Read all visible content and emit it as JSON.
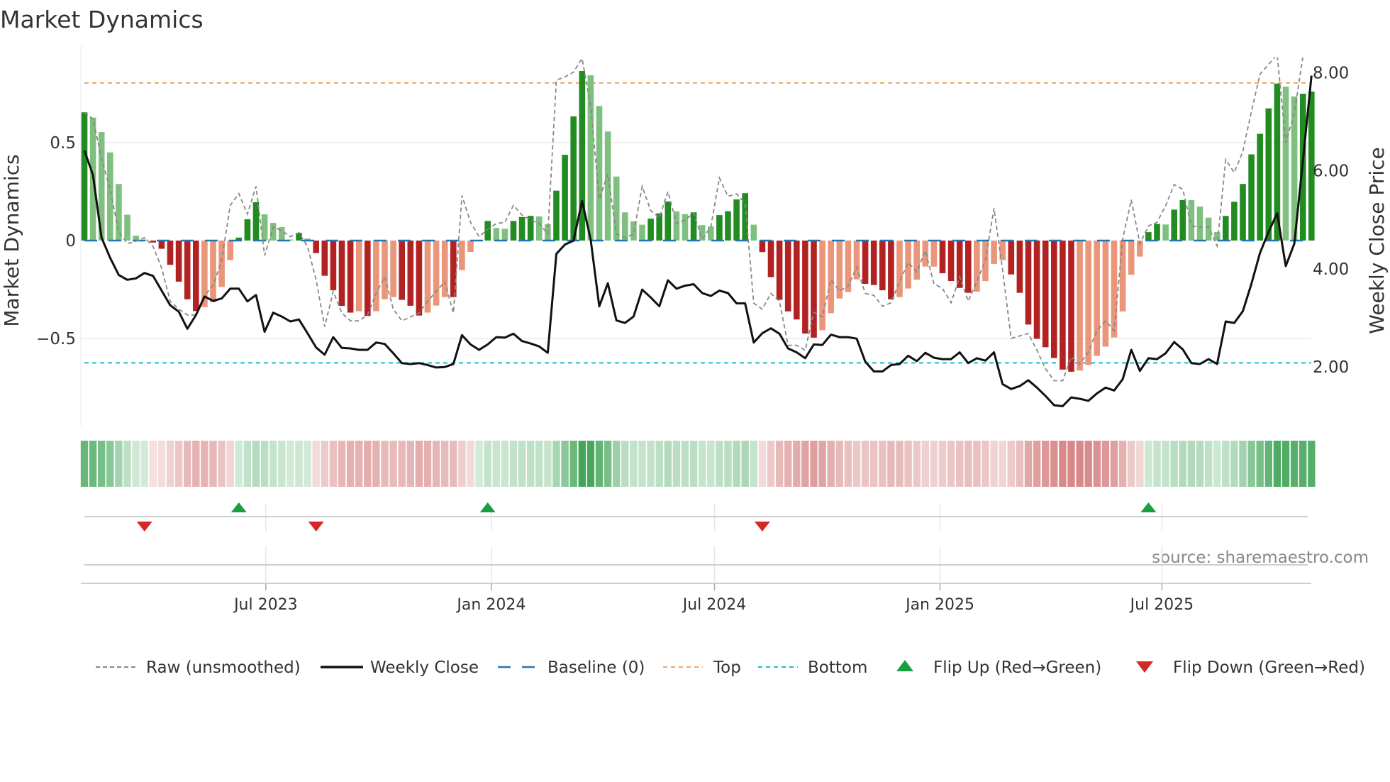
{
  "chart_data": {
    "type": "bar",
    "title": "Market Dynamics",
    "ylabel": "Market Dynamics",
    "y2label": "Weekly Close Price",
    "ylim": [
      -0.946,
      0.935
    ],
    "y2lim": [
      0.78,
      8.3
    ],
    "yticks": [
      {
        "v": 0.5,
        "label": "0.5"
      },
      {
        "v": 0,
        "label": "0"
      },
      {
        "v": -0.5,
        "label": "−0.5"
      }
    ],
    "y2ticks": [
      {
        "v": 8,
        "label": "8.00"
      },
      {
        "v": 6,
        "label": "6.00"
      },
      {
        "v": 4,
        "label": "4.00"
      },
      {
        "v": 2,
        "label": "2.00"
      }
    ],
    "x_start_date": "2023-02-03",
    "x_step": "weekly",
    "xticks": [
      {
        "date": "2023-07-01",
        "label": "Jul 2023"
      },
      {
        "date": "2024-01-01",
        "label": "Jan 2024"
      },
      {
        "date": "2024-07-01",
        "label": "Jul 2024"
      },
      {
        "date": "2025-01-01",
        "label": "Jan 2025"
      },
      {
        "date": "2025-07-01",
        "label": "Jul 2025"
      }
    ],
    "top_level": 0.805,
    "bottom_level": -0.625,
    "baseline": 0,
    "dynamics": [
      0.655,
      0.628,
      0.554,
      0.45,
      0.289,
      0.132,
      0.025,
      0.005,
      -0.01,
      -0.042,
      -0.124,
      -0.21,
      -0.3,
      -0.36,
      -0.34,
      -0.315,
      -0.237,
      -0.1,
      0.015,
      0.109,
      0.196,
      0.134,
      0.09,
      0.069,
      0.005,
      0.039,
      0.01,
      -0.064,
      -0.18,
      -0.254,
      -0.334,
      -0.368,
      -0.361,
      -0.385,
      -0.361,
      -0.3,
      -0.289,
      -0.303,
      -0.333,
      -0.383,
      -0.368,
      -0.332,
      -0.289,
      -0.289,
      -0.151,
      -0.058,
      0.0,
      0.1,
      0.064,
      0.06,
      0.1,
      0.12,
      0.126,
      0.123,
      0.083,
      0.255,
      0.438,
      0.634,
      0.866,
      0.844,
      0.687,
      0.557,
      0.327,
      0.144,
      0.098,
      0.081,
      0.112,
      0.139,
      0.199,
      0.149,
      0.135,
      0.144,
      0.079,
      0.072,
      0.13,
      0.15,
      0.21,
      0.242,
      0.081,
      -0.059,
      -0.187,
      -0.303,
      -0.362,
      -0.403,
      -0.475,
      -0.496,
      -0.458,
      -0.371,
      -0.296,
      -0.263,
      -0.198,
      -0.221,
      -0.227,
      -0.254,
      -0.3,
      -0.289,
      -0.245,
      -0.2,
      -0.133,
      -0.133,
      -0.167,
      -0.207,
      -0.242,
      -0.267,
      -0.261,
      -0.207,
      -0.12,
      -0.1,
      -0.173,
      -0.267,
      -0.429,
      -0.502,
      -0.545,
      -0.6,
      -0.659,
      -0.67,
      -0.664,
      -0.635,
      -0.589,
      -0.542,
      -0.495,
      -0.362,
      -0.175,
      -0.082,
      0.043,
      0.085,
      0.082,
      0.158,
      0.207,
      0.207,
      0.173,
      0.117,
      0.043,
      0.126,
      0.198,
      0.289,
      0.44,
      0.545,
      0.675,
      0.802,
      0.786,
      0.736,
      0.75,
      0.761
    ],
    "strong": [
      1,
      0,
      0,
      0,
      0,
      0,
      0,
      0,
      1,
      1,
      1,
      1,
      1,
      1,
      0,
      0,
      0,
      0,
      1,
      1,
      1,
      0,
      0,
      0,
      0,
      1,
      0,
      1,
      1,
      1,
      1,
      1,
      0,
      1,
      0,
      0,
      0,
      1,
      1,
      1,
      0,
      0,
      0,
      1,
      0,
      0,
      0,
      1,
      0,
      0,
      1,
      1,
      1,
      0,
      0,
      1,
      1,
      1,
      1,
      0,
      0,
      0,
      0,
      0,
      0,
      0,
      1,
      1,
      1,
      0,
      0,
      1,
      0,
      0,
      1,
      1,
      1,
      1,
      0,
      1,
      1,
      1,
      1,
      1,
      1,
      1,
      0,
      0,
      0,
      0,
      0,
      1,
      1,
      1,
      1,
      0,
      0,
      0,
      0,
      0,
      1,
      1,
      1,
      1,
      0,
      0,
      0,
      0,
      1,
      1,
      1,
      1,
      1,
      1,
      1,
      1,
      0,
      0,
      0,
      0,
      0,
      0,
      0,
      0,
      1,
      1,
      0,
      1,
      1,
      0,
      0,
      0,
      0,
      1,
      1,
      1,
      1,
      1,
      1,
      1,
      0,
      0,
      1,
      1
    ],
    "raw": [
      0.655,
      0.62,
      0.42,
      0.26,
      0.045,
      -0.016,
      -0.004,
      0.015,
      -0.03,
      -0.14,
      -0.31,
      -0.35,
      -0.38,
      -0.38,
      -0.28,
      -0.23,
      -0.1,
      0.18,
      0.24,
      0.135,
      0.277,
      -0.076,
      0.07,
      0.05,
      0.02,
      0.04,
      -0.03,
      -0.2,
      -0.44,
      -0.26,
      -0.37,
      -0.41,
      -0.41,
      -0.38,
      -0.27,
      -0.185,
      -0.35,
      -0.41,
      -0.39,
      -0.37,
      -0.31,
      -0.26,
      -0.21,
      -0.37,
      0.23,
      0.093,
      0.02,
      0.057,
      0.087,
      0.093,
      0.18,
      0.13,
      0.105,
      0.087,
      0.033,
      0.82,
      0.836,
      0.86,
      0.93,
      0.685,
      0.21,
      0.34,
      0.033,
      0.015,
      0.033,
      0.277,
      0.153,
      0.117,
      0.25,
      0.087,
      0.105,
      0.14,
      0.008,
      0.07,
      0.32,
      0.226,
      0.238,
      0.19,
      -0.32,
      -0.35,
      -0.27,
      -0.31,
      -0.535,
      -0.535,
      -0.56,
      -0.366,
      -0.39,
      -0.2,
      -0.257,
      -0.233,
      -0.136,
      -0.27,
      -0.28,
      -0.336,
      -0.318,
      -0.21,
      -0.112,
      -0.16,
      -0.052,
      -0.22,
      -0.245,
      -0.318,
      -0.185,
      -0.31,
      -0.21,
      -0.1,
      0.165,
      -0.149,
      -0.5,
      -0.487,
      -0.475,
      -0.56,
      -0.655,
      -0.716,
      -0.716,
      -0.595,
      -0.63,
      -0.57,
      -0.46,
      -0.41,
      -0.46,
      0.008,
      0.208,
      -0.016,
      0.075,
      0.093,
      0.178,
      0.286,
      0.262,
      0.075,
      0.069,
      0.069,
      -0.028,
      0.413,
      0.347,
      0.455,
      0.66,
      0.85,
      0.9,
      0.95,
      0.5,
      0.65,
      0.94,
      1.05
    ],
    "close": [
      6.4,
      5.9,
      4.62,
      4.21,
      3.86,
      3.76,
      3.79,
      3.9,
      3.84,
      3.54,
      3.24,
      3.11,
      2.76,
      3.04,
      3.42,
      3.33,
      3.38,
      3.58,
      3.58,
      3.32,
      3.45,
      2.7,
      3.09,
      3.01,
      2.91,
      2.95,
      2.67,
      2.38,
      2.23,
      2.59,
      2.37,
      2.36,
      2.33,
      2.33,
      2.48,
      2.45,
      2.26,
      2.06,
      2.04,
      2.06,
      2.02,
      1.97,
      1.98,
      2.04,
      2.63,
      2.44,
      2.33,
      2.44,
      2.59,
      2.58,
      2.66,
      2.51,
      2.46,
      2.4,
      2.27,
      4.29,
      4.48,
      4.56,
      5.37,
      4.58,
      3.22,
      3.69,
      2.93,
      2.88,
      3.01,
      3.56,
      3.4,
      3.22,
      3.75,
      3.58,
      3.64,
      3.67,
      3.49,
      3.43,
      3.54,
      3.49,
      3.28,
      3.28,
      2.48,
      2.67,
      2.77,
      2.66,
      2.36,
      2.28,
      2.16,
      2.44,
      2.43,
      2.64,
      2.59,
      2.59,
      2.56,
      2.09,
      1.89,
      1.89,
      2.02,
      2.04,
      2.21,
      2.1,
      2.27,
      2.17,
      2.14,
      2.14,
      2.28,
      2.06,
      2.16,
      2.11,
      2.28,
      1.63,
      1.53,
      1.59,
      1.71,
      1.56,
      1.39,
      1.2,
      1.18,
      1.36,
      1.33,
      1.29,
      1.44,
      1.56,
      1.5,
      1.73,
      2.33,
      1.9,
      2.16,
      2.14,
      2.26,
      2.49,
      2.34,
      2.06,
      2.04,
      2.14,
      2.04,
      2.91,
      2.88,
      3.12,
      3.68,
      4.31,
      4.74,
      5.12,
      4.04,
      4.5,
      6.19,
      7.93
    ],
    "flip_up_index": [
      18,
      47,
      124
    ],
    "flip_down_index": [
      7,
      27,
      79
    ],
    "legend": {
      "placement": "bottom",
      "items": [
        {
          "label": "Raw (unsmoothed)",
          "kind": "raw"
        },
        {
          "label": "Weekly Close",
          "kind": "close"
        },
        {
          "label": "Baseline (0)",
          "kind": "baseline"
        },
        {
          "label": "Top",
          "kind": "top"
        },
        {
          "label": "Bottom",
          "kind": "bottom"
        },
        {
          "label": "Flip Up (Red→Green)",
          "kind": "up"
        },
        {
          "label": "Flip Down (Green→Red)",
          "kind": "down"
        }
      ]
    },
    "source": "source: sharemaestro.com",
    "colors": {
      "green_strong": "#228b22",
      "green_weak": "#7fbf7f",
      "red_strong": "#b22222",
      "red_weak": "#e9967a",
      "raw": "#888888",
      "close": "#111111",
      "baseline": "#1f77b4",
      "top": "#f4a460",
      "bottom": "#17becf",
      "flip_up": "#1a9e3f",
      "flip_down": "#d62728"
    }
  }
}
